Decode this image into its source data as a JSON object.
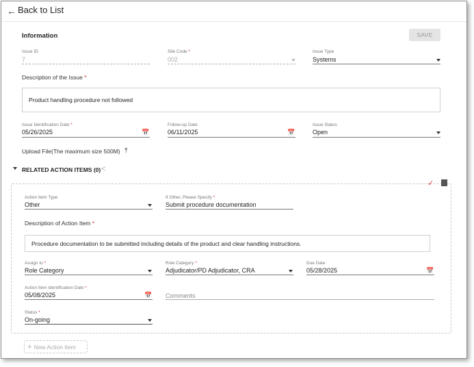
{
  "nav": {
    "back_icon": "arrow-left-icon",
    "back_label": "Back to List"
  },
  "information": {
    "title": "Information",
    "save_label": "SAVE",
    "issue_id": {
      "label": "Issue ID",
      "value": "7"
    },
    "site_code": {
      "label": "Site Code",
      "required": "*",
      "value": "002"
    },
    "issue_type": {
      "label": "Issue Type",
      "value": "Systems"
    },
    "description": {
      "label": "Description of the Issue",
      "required": "*",
      "value": "Product handling procedure not followed"
    },
    "identification_date": {
      "label": "Issue Identification Date",
      "required": "*",
      "value": "05/26/2025"
    },
    "followup_date": {
      "label": "Follow-up Date",
      "value": "06/11/2025"
    },
    "issue_status": {
      "label": "Issue Status",
      "value": "Open"
    },
    "upload": {
      "label": "Upload File(The maximum size 500M)",
      "icon": "upload-icon"
    }
  },
  "related": {
    "title": "RELATED ACTION ITEMS (0)",
    "collapse_icon": "caret-down-icon",
    "share_icon": "share-icon"
  },
  "action_item": {
    "action_type": {
      "label": "Action Item Type",
      "value": "Other"
    },
    "if_other": {
      "label": "If Other, Please Specify",
      "required": "*",
      "value": "Submit procedure documentation"
    },
    "description": {
      "label": "Description of Action Item",
      "required": "*",
      "value": "Procedure documentation to be submitted including details of the product and clear handling instructions."
    },
    "assign_to": {
      "label": "Assign to",
      "required": "*",
      "value": "Role Category"
    },
    "role_category": {
      "label": "Role Category",
      "required": "*",
      "value": "Adjudicator/PD Adjudicator, CRA"
    },
    "due_date": {
      "label": "Due Date",
      "value": "05/28/2025"
    },
    "identification_date": {
      "label": "Action Item Identification Date",
      "required": "*",
      "value": "05/08/2025"
    },
    "comments": {
      "placeholder": "Comments"
    },
    "status": {
      "label": "Status",
      "required": "*",
      "value": "On-going"
    }
  },
  "new_action": {
    "label": "New Action Item",
    "icon": "plus-icon"
  },
  "colors": {
    "required": "#d32f2f",
    "check": "#e53935",
    "save_bg": "#e4e4e4"
  }
}
